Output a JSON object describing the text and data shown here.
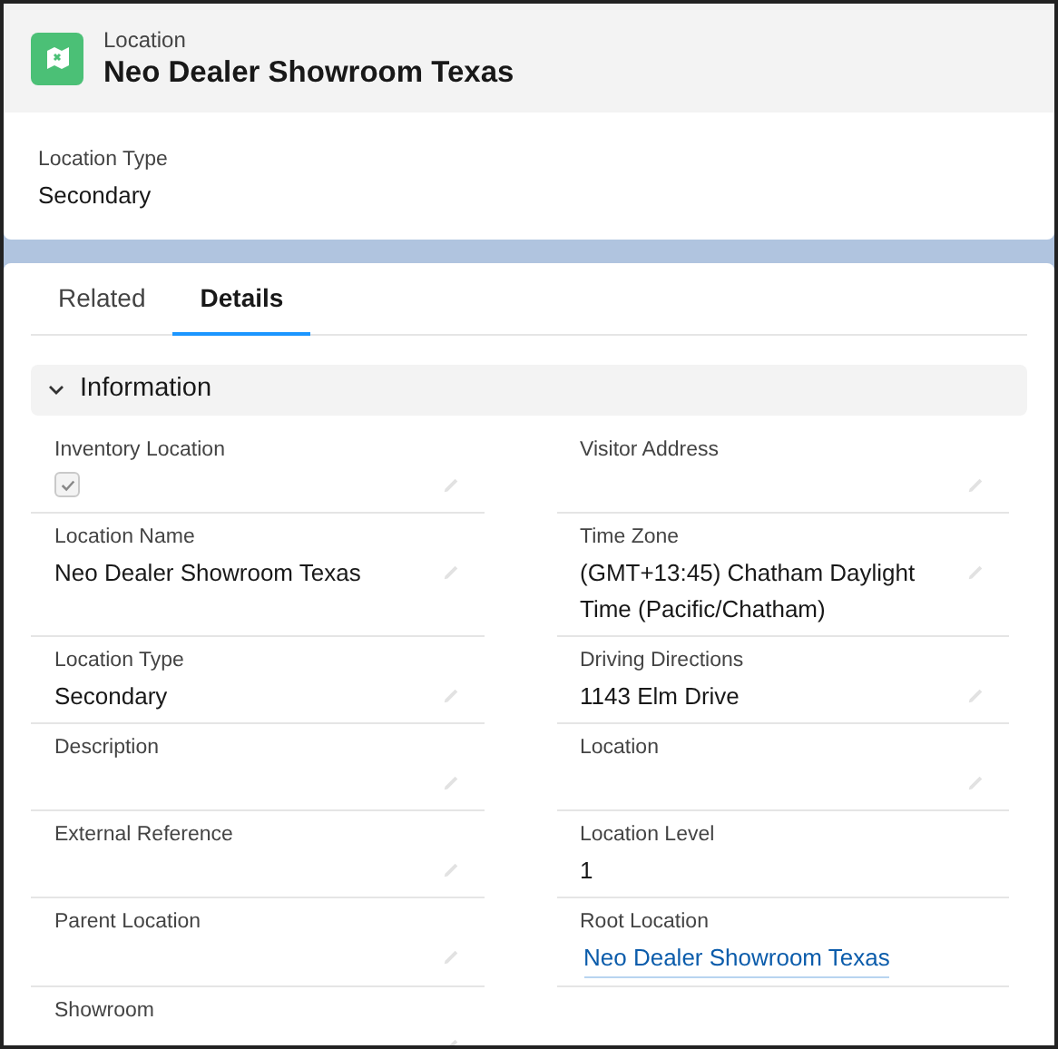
{
  "header": {
    "object_type": "Location",
    "title": "Neo Dealer Showroom Texas"
  },
  "highlights": [
    {
      "label": "Location Type",
      "value": "Secondary"
    }
  ],
  "tabs": [
    {
      "label": "Related",
      "selected": false
    },
    {
      "label": "Details",
      "selected": true
    }
  ],
  "section": {
    "title": "Information",
    "expanded": true
  },
  "rows": [
    {
      "left": {
        "kind": "checkbox",
        "label": "Inventory Location",
        "checked": true
      },
      "right": {
        "kind": "text",
        "label": "Visitor Address"
      }
    },
    {
      "left": {
        "kind": "text",
        "label": "Location Name",
        "value": "Neo Dealer Showroom Texas"
      },
      "right": {
        "kind": "text",
        "label": "Time Zone",
        "value": "(GMT+13:45) Chatham Daylight Time (Pacific/Chatham)"
      }
    },
    {
      "left": {
        "kind": "text",
        "label": "Location Type",
        "value": "Secondary"
      },
      "right": {
        "kind": "text",
        "label": "Driving Directions",
        "value": "1143 Elm Drive"
      }
    },
    {
      "left": {
        "kind": "text",
        "label": "Description"
      },
      "right": {
        "kind": "text",
        "label": "Location"
      }
    },
    {
      "left": {
        "kind": "text",
        "label": "External Reference"
      },
      "right": {
        "kind": "text",
        "label": "Location Level",
        "value": "1"
      }
    },
    {
      "left": {
        "kind": "text",
        "label": "Parent Location"
      },
      "right": {
        "kind": "link",
        "label": "Root Location",
        "value": "Neo Dealer Showroom Texas"
      }
    },
    {
      "left": {
        "kind": "text",
        "label": "Showroom"
      }
    }
  ]
}
